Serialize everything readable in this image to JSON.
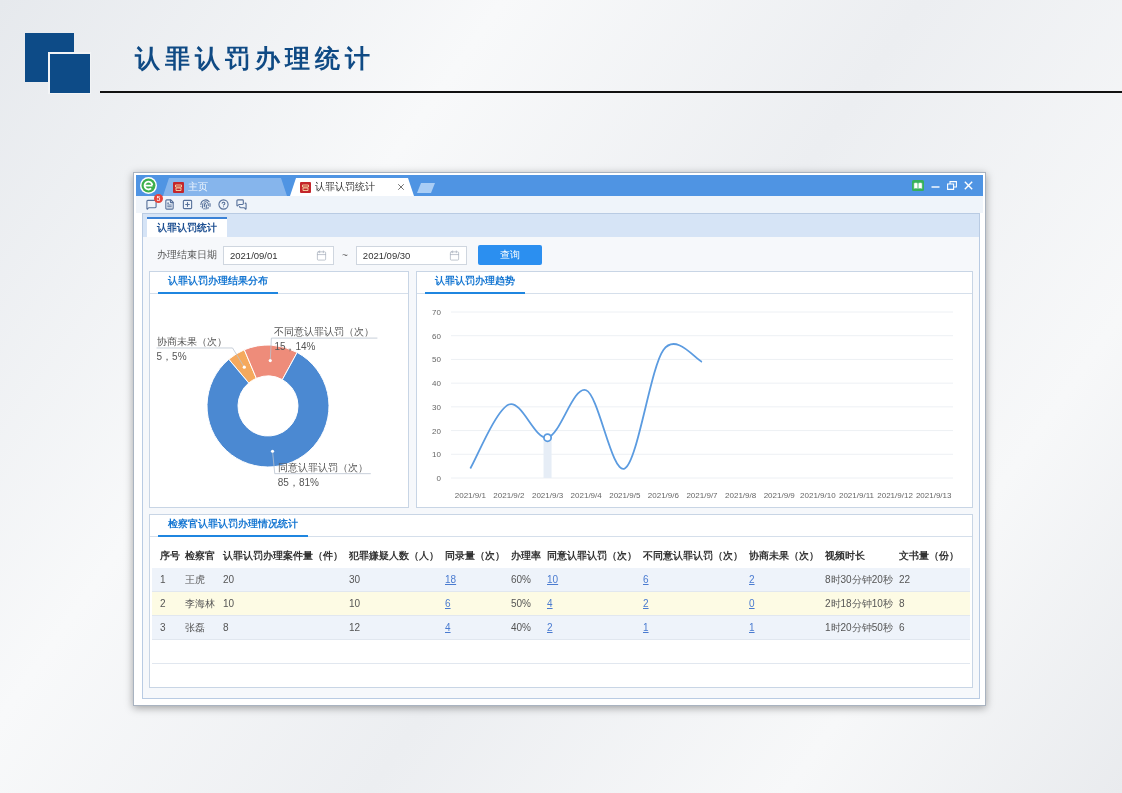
{
  "page_title": "认罪认罚办理统计",
  "browser": {
    "tabs": [
      {
        "label": "主页",
        "selected": false
      },
      {
        "label": "认罪认罚统计",
        "selected": true
      }
    ],
    "badge": "5"
  },
  "page_tabs": [
    {
      "label": "认罪认罚统计",
      "selected": true
    }
  ],
  "filter": {
    "label": "办理结束日期",
    "start_date": "2021/09/01",
    "separator": "~",
    "end_date": "2021/09/30",
    "button": "查询"
  },
  "result_panel": {
    "title": "认罪认罚办理结果分布",
    "chart_data": {
      "type": "donut",
      "categories": [
        "协商未果（次）",
        "不同意认罪认罚（次）",
        "同意认罪认罚（次）"
      ],
      "values": [
        5,
        15,
        85
      ],
      "value_labels": [
        "5，5%",
        "15，14%",
        "85，81%"
      ]
    }
  },
  "trend_panel": {
    "title": "认罪认罚办理趋势",
    "chart_data": {
      "type": "line",
      "categories": [
        "2021/9/1",
        "2021/9/2",
        "2021/9/3",
        "2021/9/4",
        "2021/9/5",
        "2021/9/6",
        "2021/9/7",
        "2021/9/8",
        "2021/9/9",
        "2021/9/10",
        "2021/9/11",
        "2021/9/12",
        "2021/9/13"
      ],
      "values": [
        4,
        31,
        17,
        37,
        4,
        54,
        49,
        null,
        null,
        null,
        null,
        null,
        null
      ],
      "ylim": [
        0,
        70
      ],
      "yticks": [
        0,
        10,
        20,
        30,
        40,
        50,
        60,
        70
      ],
      "grid": true,
      "annotations": [
        {
          "x": "2021/9/3"
        }
      ]
    }
  },
  "table_panel": {
    "title": "检察官认罪认罚办理情况统计",
    "table": {
      "columns": [
        {
          "label": "序号",
          "kind": "text"
        },
        {
          "label": "检察官",
          "kind": "text"
        },
        {
          "label": "认罪认罚办理案件量（件）",
          "kind": "text"
        },
        {
          "label": "犯罪嫌疑人数（人）",
          "kind": "text"
        },
        {
          "label": "同录量（次）",
          "kind": "link"
        },
        {
          "label": "办理率",
          "kind": "text"
        },
        {
          "label": "同意认罪认罚（次）",
          "kind": "link"
        },
        {
          "label": "不同意认罪认罚（次）",
          "kind": "link"
        },
        {
          "label": "协商未果（次）",
          "kind": "link"
        },
        {
          "label": "视频时长",
          "kind": "text"
        },
        {
          "label": "文书量（份）",
          "kind": "text"
        }
      ],
      "rows": [
        {
          "cells": [
            "1",
            "王虎",
            "20",
            "30",
            "18",
            "60%",
            "10",
            "6",
            "2",
            "8时30分钟20秒",
            "22"
          ],
          "selected": false
        },
        {
          "cells": [
            "2",
            "李海林",
            "10",
            "10",
            "6",
            "50%",
            "4",
            "2",
            "0",
            "2时18分钟10秒",
            "8"
          ],
          "selected": true
        },
        {
          "cells": [
            "3",
            "张磊",
            "8",
            "12",
            "4",
            "40%",
            "2",
            "1",
            "1",
            "1时20分钟50秒",
            "6"
          ],
          "selected": false
        }
      ]
    }
  }
}
